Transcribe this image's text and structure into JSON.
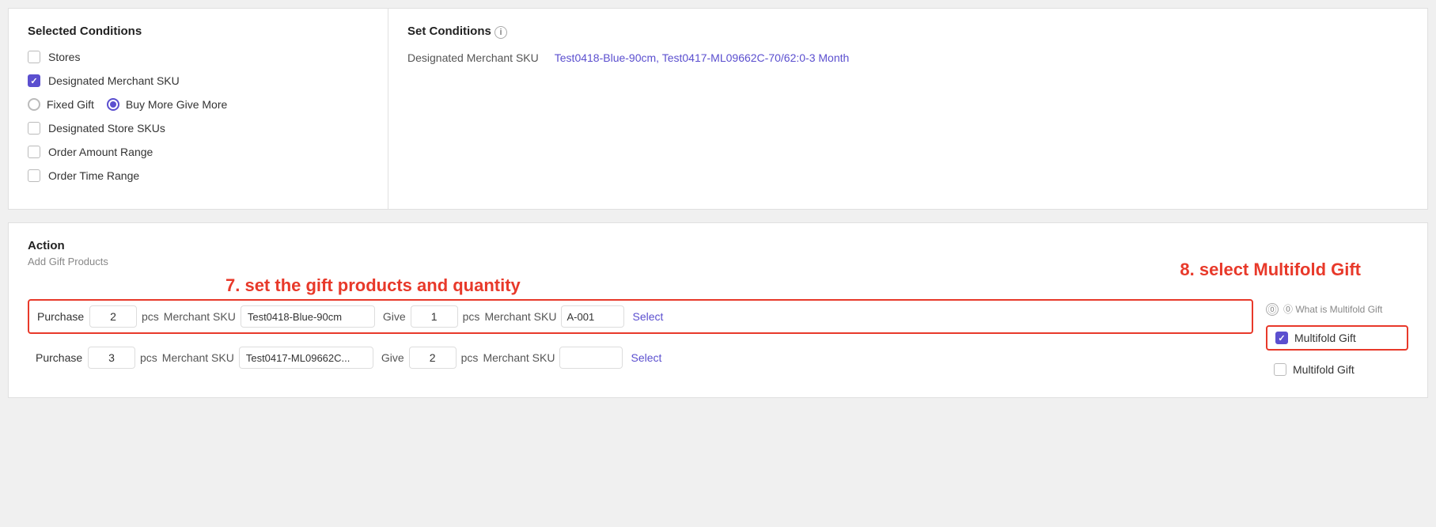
{
  "selectedConditions": {
    "title": "Selected Conditions",
    "items": [
      {
        "id": "stores",
        "label": "Stores",
        "type": "checkbox",
        "checked": false
      },
      {
        "id": "designated-merchant-sku",
        "label": "Designated Merchant SKU",
        "type": "checkbox",
        "checked": true
      },
      {
        "id": "fixed-gift",
        "label": "Fixed Gift",
        "type": "radio",
        "checked": false
      },
      {
        "id": "buy-more-give-more",
        "label": "Buy More Give More",
        "type": "radio",
        "checked": true
      },
      {
        "id": "designated-store-skus",
        "label": "Designated Store SKUs",
        "type": "checkbox",
        "checked": false
      },
      {
        "id": "order-amount-range",
        "label": "Order Amount Range",
        "type": "checkbox",
        "checked": false
      },
      {
        "id": "order-time-range",
        "label": "Order Time Range",
        "type": "checkbox",
        "checked": false
      }
    ]
  },
  "setConditions": {
    "title": "Set Conditions",
    "rows": [
      {
        "label": "Designated Merchant SKU",
        "value": "Test0418-Blue-90cm, Test0417-ML09662C-70/62:0-3 Month"
      }
    ]
  },
  "action": {
    "title": "Action",
    "addGiftLabel": "Add Gift Products",
    "annotation7": "7. set the gift products and quantity",
    "annotation8": "8. select Multifold Gift",
    "whatIsMultifold": "⓪ What is Multifold Gift",
    "rows": [
      {
        "purchaseLabel": "Purchase",
        "purchaseQty": "2",
        "purchaseUnit": "pcs",
        "purchaseSkuLabel": "Merchant SKU",
        "purchaseSkuValue": "Test0418-Blue-90cm",
        "giveLabel": "Give",
        "giveQty": "1",
        "giveUnit": "pcs",
        "giveSkuLabel": "Merchant SKU",
        "giveSkuValue": "A-001",
        "selectLabel": "Select",
        "multifoldChecked": true,
        "multifoldLabel": "Multifold Gift",
        "highlighted": true
      },
      {
        "purchaseLabel": "Purchase",
        "purchaseQty": "3",
        "purchaseUnit": "pcs",
        "purchaseSkuLabel": "Merchant SKU",
        "purchaseSkuValue": "Test0417-ML09662C...",
        "giveLabel": "Give",
        "giveQty": "2",
        "giveUnit": "pcs",
        "giveSkuLabel": "Merchant SKU",
        "giveSkuValue": "",
        "selectLabel": "Select",
        "multifoldChecked": false,
        "multifoldLabel": "Multifold Gift",
        "highlighted": false
      }
    ]
  }
}
